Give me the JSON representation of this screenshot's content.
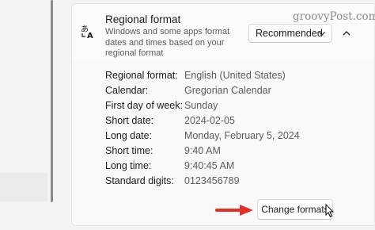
{
  "header": {
    "title": "Regional format",
    "description": "Windows and some apps format dates and times based on your regional format",
    "dropdown_value": "Recommended",
    "icon": "language-icon",
    "collapse_icon": "chevron-up-icon"
  },
  "details": [
    {
      "label": "Regional format:",
      "value": "English (United States)"
    },
    {
      "label": "Calendar:",
      "value": "Gregorian Calendar"
    },
    {
      "label": "First day of week:",
      "value": "Sunday"
    },
    {
      "label": "Short date:",
      "value": "2024-02-05"
    },
    {
      "label": "Long date:",
      "value": "Monday, February 5, 2024"
    },
    {
      "label": "Short time:",
      "value": "9:40 AM"
    },
    {
      "label": "Long time:",
      "value": "9:40:45 AM"
    },
    {
      "label": "Standard digits:",
      "value": "0123456789"
    }
  ],
  "change_button_label": "Change formats",
  "watermark": "groovyPost.com",
  "colors": {
    "annotation_arrow": "#e0312d"
  }
}
